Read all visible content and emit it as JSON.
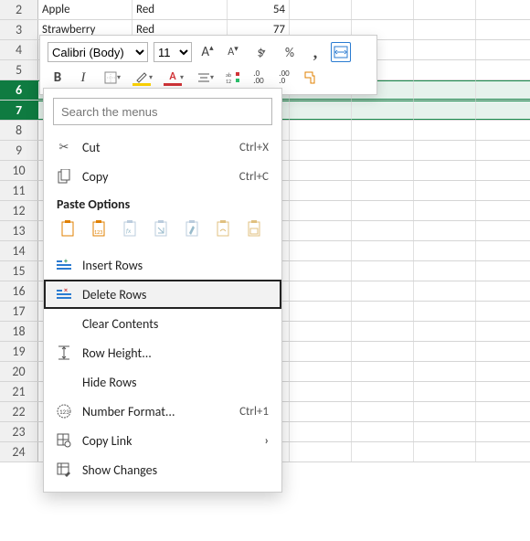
{
  "rows": [
    {
      "num": 2,
      "cells": [
        "Apple",
        "Red",
        "54"
      ]
    },
    {
      "num": 3,
      "cells": [
        "Strawberry",
        "Red",
        "77"
      ]
    },
    {
      "num": 4,
      "cells": [
        "",
        "",
        ""
      ]
    },
    {
      "num": 5,
      "cells": [
        "",
        "",
        ""
      ]
    },
    {
      "num": 6,
      "cells": [
        "",
        "",
        ""
      ],
      "selected": true
    },
    {
      "num": 7,
      "cells": [
        "",
        "",
        ""
      ],
      "selected": true
    },
    {
      "num": 8
    },
    {
      "num": 9
    },
    {
      "num": 10
    },
    {
      "num": 11
    },
    {
      "num": 12
    },
    {
      "num": 13
    },
    {
      "num": 14
    },
    {
      "num": 15
    },
    {
      "num": 16
    },
    {
      "num": 17
    },
    {
      "num": 18
    },
    {
      "num": 19
    },
    {
      "num": 20
    },
    {
      "num": 21
    },
    {
      "num": 22
    },
    {
      "num": 23
    },
    {
      "num": 24
    }
  ],
  "mini": {
    "font": "Calibri (Body)",
    "size": "11",
    "increase_a": "A",
    "decrease_a": "A",
    "currency": "$",
    "percent": "%",
    "comma": ",",
    "bold": "B",
    "italic": "I",
    "highlight_a": "A",
    "fontcolor_a": "A"
  },
  "ctx": {
    "search_placeholder": "Search the menus",
    "cut": "Cut",
    "cut_sc": "Ctrl+X",
    "copy": "Copy",
    "copy_sc": "Ctrl+C",
    "paste_heading": "Paste Options",
    "insert": "Insert Rows",
    "delete": "Delete Rows",
    "clear": "Clear Contents",
    "rowheight": "Row Height...",
    "hide": "Hide Rows",
    "numfmt": "Number Format...",
    "numfmt_sc": "Ctrl+1",
    "copylink": "Copy Link",
    "showchanges": "Show Changes"
  }
}
